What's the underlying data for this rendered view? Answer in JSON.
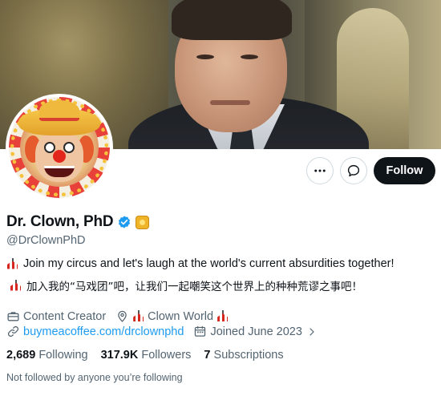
{
  "profile": {
    "display_name": "Dr. Clown, PhD",
    "handle": "@DrClownPhD",
    "bio_line_1": "Join my circus and let's laugh at the world's current absurdities together!",
    "bio_line_2": "加入我的“马戏团”吧，让我们一起嘲笑这个世界上的种种荒谬之事吧！",
    "category": "Content Creator",
    "location": "Clown World",
    "website": "buymeacoffee.com/drclownphd",
    "joined": "Joined June 2023",
    "followed_by_text": "Not followed by anyone you’re following"
  },
  "stats": {
    "following_count": "2,689",
    "following_label": "Following",
    "followers_count": "317.9K",
    "followers_label": "Followers",
    "subscriptions_count": "7",
    "subscriptions_label": "Subscriptions"
  },
  "actions": {
    "follow_label": "Follow"
  },
  "icons": {
    "more": "more-horizontal-icon",
    "message": "message-bubble-icon",
    "verified": "verified-badge-icon",
    "briefcase": "briefcase-icon",
    "location": "location-pin-icon",
    "link": "link-icon",
    "calendar": "calendar-icon",
    "circus": "circus-tent-icon"
  },
  "colors": {
    "accent": "#1d9bf0",
    "follow_button": "#0f1419",
    "secondary_text": "#536471"
  }
}
